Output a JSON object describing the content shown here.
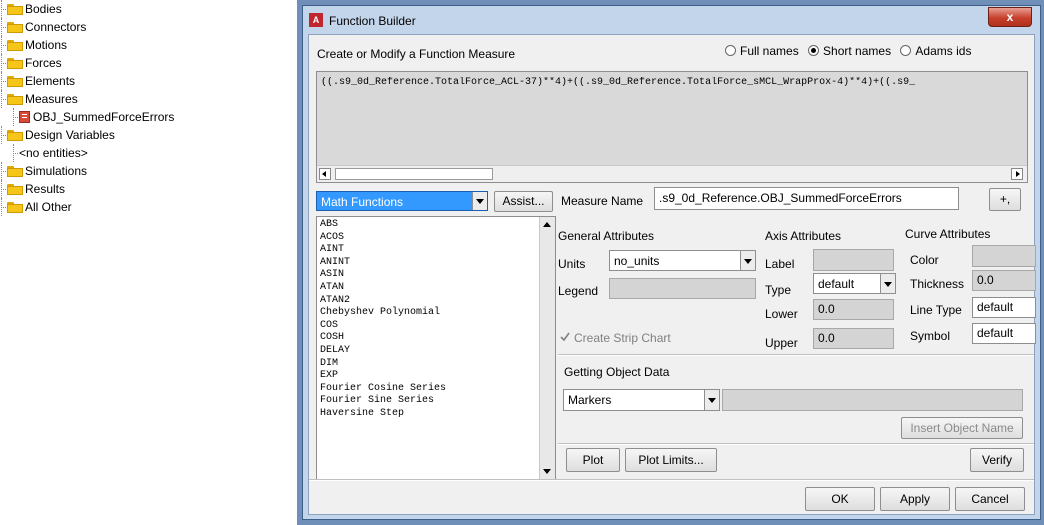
{
  "tree": {
    "items": [
      {
        "label": "Bodies",
        "icon": "folder-icon"
      },
      {
        "label": "Connectors",
        "icon": "folder-icon"
      },
      {
        "label": "Motions",
        "icon": "folder-icon"
      },
      {
        "label": "Forces",
        "icon": "folder-icon"
      },
      {
        "label": "Elements",
        "icon": "folder-icon"
      },
      {
        "label": "Measures",
        "icon": "folder-icon"
      },
      {
        "label": "OBJ_SummedForceErrors",
        "icon": "measure-icon"
      },
      {
        "label": "Design Variables",
        "icon": "folder-icon"
      },
      {
        "label": "<no entities>",
        "icon": ""
      },
      {
        "label": "Simulations",
        "icon": "folder-icon"
      },
      {
        "label": "Results",
        "icon": "folder-icon"
      },
      {
        "label": "All Other",
        "icon": "folder-icon"
      }
    ]
  },
  "window": {
    "title": "Function Builder",
    "app_icon_letter": "A",
    "close_glyph": "x"
  },
  "header": {
    "label": "Create or Modify a Function Measure",
    "name_options": [
      {
        "label": "Full names",
        "selected": false
      },
      {
        "label": "Short names",
        "selected": true
      },
      {
        "label": "Adams ids",
        "selected": false
      }
    ]
  },
  "expression": "((.s9_0d_Reference.TotalForce_ACL-37)**4)+((.s9_0d_Reference.TotalForce_sMCL_WrapProx-4)**4)+((.s9_",
  "function_panel": {
    "category": "Math Functions",
    "assist_label": "Assist...",
    "functions": [
      "ABS",
      "ACOS",
      "AINT",
      "ANINT",
      "ASIN",
      "ATAN",
      "ATAN2",
      "Chebyshev Polynomial",
      "COS",
      "COSH",
      "DELAY",
      "DIM",
      "EXP",
      "Fourier Cosine Series",
      "Fourier Sine Series",
      "Haversine Step"
    ]
  },
  "measure": {
    "name_label": "Measure Name",
    "name_value": ".s9_0d_Reference.OBJ_SummedForceErrors",
    "plus_label": "+,"
  },
  "general": {
    "heading": "General Attributes",
    "units_label": "Units",
    "units_value": "no_units",
    "legend_label": "Legend",
    "legend_value": "",
    "strip_chart_label": "Create Strip Chart",
    "strip_chart_checked": true
  },
  "axis": {
    "heading": "Axis Attributes",
    "label_label": "Label",
    "label_value": "",
    "type_label": "Type",
    "type_value": "default",
    "lower_label": "Lower",
    "lower_value": "0.0",
    "upper_label": "Upper",
    "upper_value": "0.0"
  },
  "curve": {
    "heading": "Curve Attributes",
    "color_label": "Color",
    "thickness_label": "Thickness",
    "thickness_value": "0.0",
    "linetype_label": "Line Type",
    "linetype_value": "default",
    "symbol_label": "Symbol",
    "symbol_value": "default"
  },
  "object_data": {
    "heading": "Getting Object Data",
    "type_value": "Markers",
    "insert_label": "Insert Object Name"
  },
  "actions": {
    "plot": "Plot",
    "plot_limits": "Plot Limits...",
    "verify": "Verify",
    "ok": "OK",
    "apply": "Apply",
    "cancel": "Cancel"
  },
  "colors": {
    "title_bg": "#c3d5ea",
    "category_highlight": "#3399ff",
    "close_button": "#c7402d"
  }
}
